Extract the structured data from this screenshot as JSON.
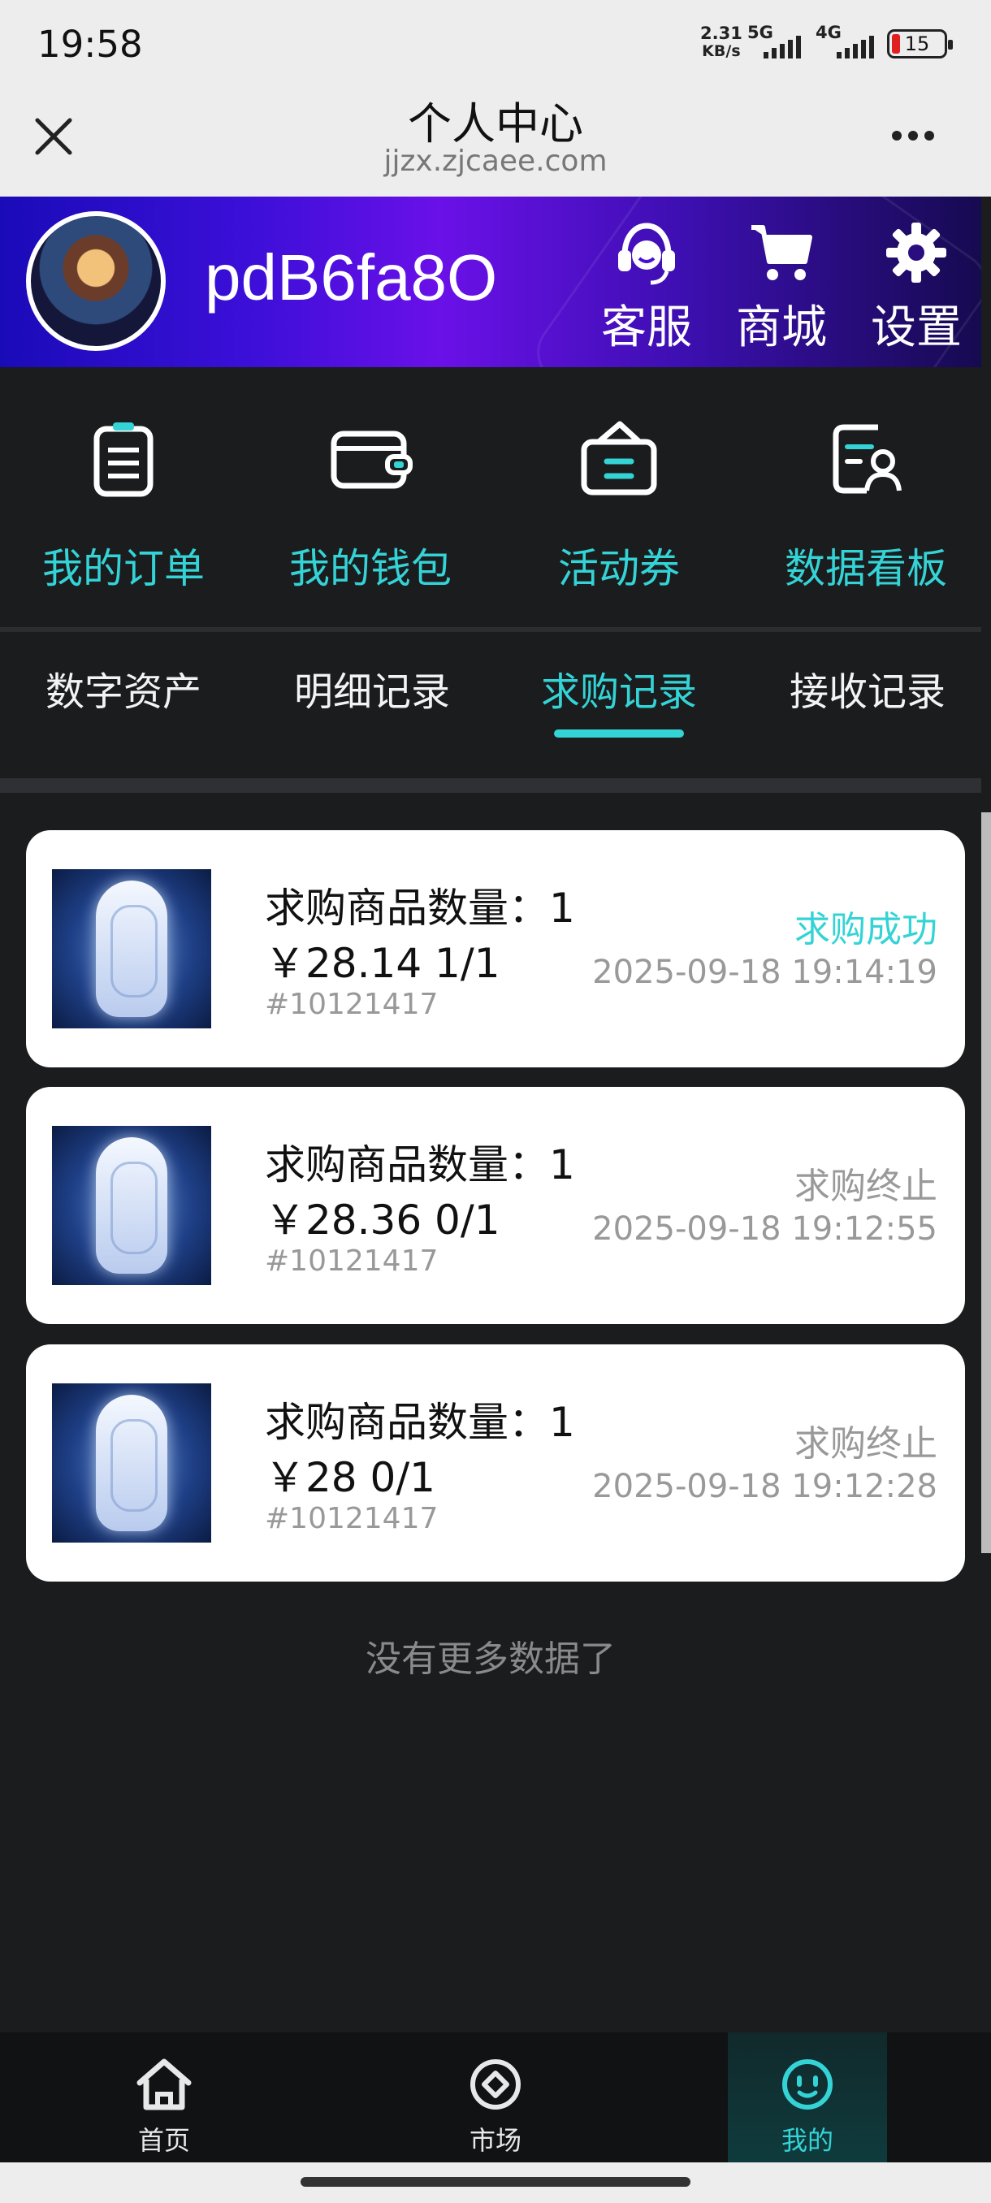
{
  "status_bar": {
    "time": "19:58",
    "net_speed_value": "2.31",
    "net_speed_unit": "KB/s",
    "net_5g": "5G",
    "net_4g": "4G",
    "battery": "15"
  },
  "browser": {
    "title": "个人中心",
    "url": "jjzx.zjcaee.com"
  },
  "profile": {
    "username": "pdB6fa8O",
    "actions": [
      {
        "label": "客服",
        "icon": "headset-icon"
      },
      {
        "label": "商城",
        "icon": "cart-icon"
      },
      {
        "label": "设置",
        "icon": "gear-icon"
      }
    ]
  },
  "quick_actions": [
    {
      "label": "我的订单",
      "icon": "order-list-icon"
    },
    {
      "label": "我的钱包",
      "icon": "wallet-icon"
    },
    {
      "label": "活动券",
      "icon": "coupon-icon"
    },
    {
      "label": "数据看板",
      "icon": "dashboard-icon"
    }
  ],
  "tabs": [
    {
      "label": "数字资产",
      "active": false
    },
    {
      "label": "明细记录",
      "active": false
    },
    {
      "label": "求购记录",
      "active": true
    },
    {
      "label": "接收记录",
      "active": false
    }
  ],
  "records": [
    {
      "quantity_text": "求购商品数量：1",
      "price_text": "￥28.14 1/1",
      "id": "#10121417",
      "status": "求购成功",
      "date": "2025-09-18 19:14:19"
    },
    {
      "quantity_text": "求购商品数量：1",
      "price_text": "￥28.36 0/1",
      "id": "#10121417",
      "status": "求购终止",
      "date": "2025-09-18 19:12:55"
    },
    {
      "quantity_text": "求购商品数量：1",
      "price_text": "￥28 0/1",
      "id": "#10121417",
      "status": "求购终止",
      "date": "2025-09-18 19:12:28"
    }
  ],
  "no_more_text": "没有更多数据了",
  "bottom_nav": [
    {
      "label": "首页",
      "icon": "home-icon",
      "active": false
    },
    {
      "label": "市场",
      "icon": "market-icon",
      "active": false
    },
    {
      "label": "我的",
      "icon": "profile-face-icon",
      "active": true
    }
  ],
  "colors": {
    "accent": "#34d3d6",
    "background": "#1b1c1e",
    "card": "#ffffff",
    "muted": "#999999"
  }
}
